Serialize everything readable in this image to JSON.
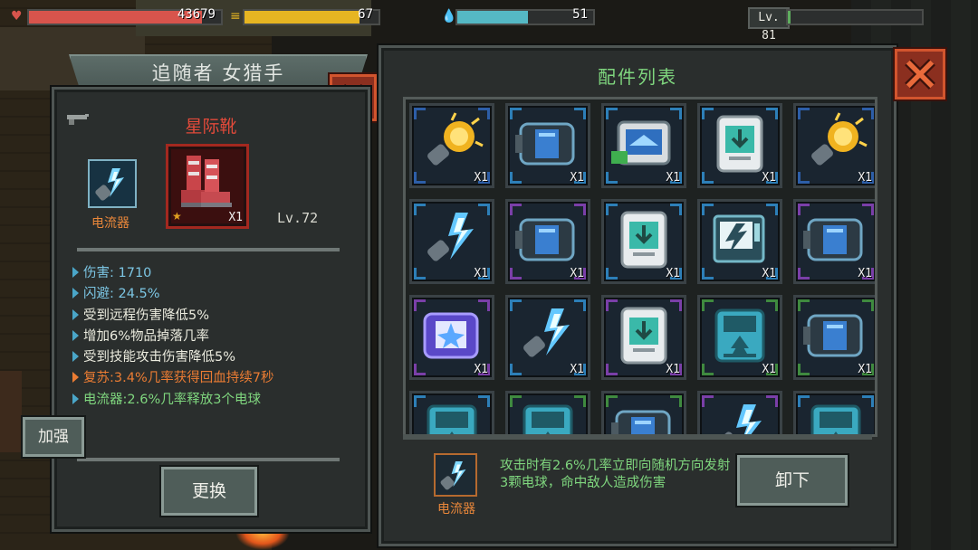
{
  "hud": {
    "health": {
      "value": "43679",
      "fill": 0.9,
      "color": "#d8544c",
      "icon": "heart-icon"
    },
    "energy": {
      "value": "67",
      "fill": 0.86,
      "color": "#e6b522",
      "icon": "coin-stack-icon"
    },
    "mana": {
      "value": "51",
      "fill": 0.52,
      "color": "#55b8c4",
      "icon": "water-drop-icon"
    },
    "level": {
      "label": "Lv. 81",
      "fill": 0.02,
      "color": "#5fae5f"
    }
  },
  "follower_panel": {
    "title": "追随者 女猎手",
    "item_name": "星际靴",
    "accessory_label": "电流器",
    "boots_count": "X1",
    "item_level": "Lv.72",
    "stats": [
      {
        "text": "伤害: 1710",
        "style": "blue"
      },
      {
        "text": "闪避: 24.5%",
        "style": "blue"
      },
      {
        "text": "受到远程伤害降低5%",
        "style": "white"
      },
      {
        "text": "增加6%物品掉落几率",
        "style": "white"
      },
      {
        "text": "受到技能攻击伤害降低5%",
        "style": "white"
      },
      {
        "text": "复苏:3.4%几率获得回血持续7秒",
        "style": "orange"
      },
      {
        "text": "电流器:2.6%几率释放3个电球",
        "style": "green"
      }
    ],
    "strengthen_label": "加强",
    "swap_label": "更换"
  },
  "accessory_panel": {
    "title": "配件列表",
    "items": [
      {
        "icon": "spark-capsule-icon",
        "count": "X1",
        "frame": "#2d5ea8",
        "rarity": "blue"
      },
      {
        "icon": "shield-module-icon",
        "count": "X1",
        "frame": "#2d7fb8",
        "rarity": "blue"
      },
      {
        "icon": "wing-module-icon",
        "count": "X1",
        "frame": "#2d7fb8",
        "rarity": "blue"
      },
      {
        "icon": "download-module-icon",
        "count": "X1",
        "frame": "#2d7fb8",
        "rarity": "blue"
      },
      {
        "icon": "spark-capsule-icon",
        "count": "X1",
        "frame": "#2d5ea8",
        "rarity": "blue"
      },
      {
        "icon": "electric-capsule-icon",
        "count": "X1",
        "frame": "#2d7fb8",
        "rarity": "blue"
      },
      {
        "icon": "shield-module-icon",
        "count": "X1",
        "frame": "#7a3fa8",
        "rarity": "purple"
      },
      {
        "icon": "download-module-icon",
        "count": "X1",
        "frame": "#2d7fb8",
        "rarity": "blue"
      },
      {
        "icon": "lightning-module-icon",
        "count": "X1",
        "frame": "#2d7fb8",
        "rarity": "blue"
      },
      {
        "icon": "shield-module-icon",
        "count": "X1",
        "frame": "#7a3fa8",
        "rarity": "purple"
      },
      {
        "icon": "star-module-icon",
        "count": "X1",
        "frame": "#7a3fa8",
        "rarity": "purple"
      },
      {
        "icon": "electric-capsule-icon",
        "count": "X1",
        "frame": "#2d7fb8",
        "rarity": "blue"
      },
      {
        "icon": "download-module-icon",
        "count": "X1",
        "frame": "#7a3fa8",
        "rarity": "purple"
      },
      {
        "icon": "tree-module-icon",
        "count": "X1",
        "frame": "#3f8a3f",
        "rarity": "green"
      },
      {
        "icon": "shield-module-icon",
        "count": "X1",
        "frame": "#3f8a3f",
        "rarity": "green"
      },
      {
        "icon": "tree-module-icon",
        "count": "",
        "frame": "#2d7fb8",
        "rarity": "blue"
      },
      {
        "icon": "tree-module-icon",
        "count": "",
        "frame": "#3f8a3f",
        "rarity": "green"
      },
      {
        "icon": "shield-module-icon",
        "count": "",
        "frame": "#3f8a3f",
        "rarity": "green"
      },
      {
        "icon": "electric-capsule-icon",
        "count": "",
        "frame": "#7a3fa8",
        "rarity": "purple"
      },
      {
        "icon": "tree-module-icon",
        "count": "",
        "frame": "#2d7fb8",
        "rarity": "blue"
      }
    ],
    "selected_label": "电流器",
    "description": "攻击时有2.6%几率立即向随机方向发射3颗电球，命中敌人造成伤害",
    "unequip_label": "卸下"
  }
}
